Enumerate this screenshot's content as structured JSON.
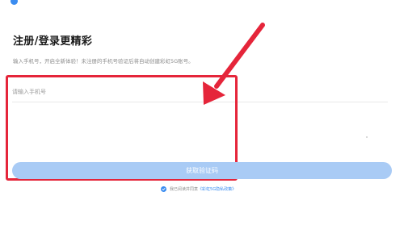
{
  "header": {
    "title": "注册/登录更精彩",
    "subtitle": "输入手机号，开启全新体验！未注册的手机号验证后将自动创建彩虹5G账号。"
  },
  "form": {
    "phone_placeholder": "请输入手机号",
    "phone_value": "",
    "get_code_label": "获取验证码"
  },
  "agreement": {
    "checked": true,
    "prefix_text": "我已阅读并同意",
    "link_text": "《彩虹5G隐私政策》"
  },
  "annotation": {
    "highlight_color": "#e5253a"
  },
  "colors": {
    "accent": "#3a8cf0",
    "button_disabled": "#a9cbf5",
    "annotation_red": "#e5253a"
  },
  "icons": {
    "status": "status-dot-icon",
    "check": "checkmark-circle-icon",
    "annotation_arrow": "arrow-icon"
  }
}
